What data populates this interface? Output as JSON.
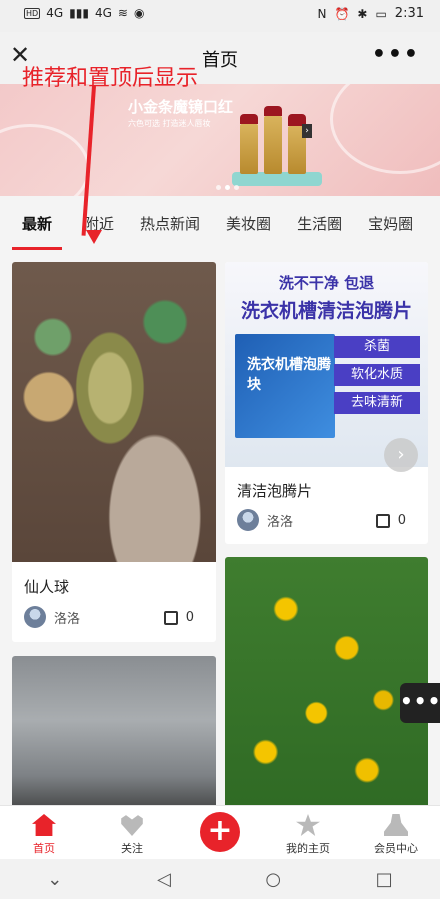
{
  "status_bar": {
    "signal_left": "4G",
    "signal_right": "4G",
    "time": "2:31"
  },
  "nav": {
    "title": "首页",
    "more": "•••"
  },
  "annotation": {
    "text": "推荐和置顶后显示"
  },
  "banner": {
    "title": "小金条魔镜口红",
    "subtitle": "六色可选 打造迷人唇妆",
    "brand": "TREECHADA"
  },
  "tabs": [
    "最新",
    "附近",
    "热点新闻",
    "美妆圈",
    "生活圈",
    "宝妈圈"
  ],
  "cards": [
    {
      "caption": "仙人球",
      "author": "洛洛",
      "likes": "0"
    },
    {
      "caption": "清洁泡腾片",
      "author": "洛洛",
      "likes": "0",
      "ad": {
        "headline": "洗不干净 包退",
        "title": "洗衣机槽清洁泡腾片",
        "tags": [
          "杀菌",
          "软化水质",
          "去味清新"
        ],
        "box_label": "洗衣机槽泡腾块"
      }
    },
    {
      "caption": "",
      "author": "",
      "likes": ""
    },
    {
      "caption": "",
      "author": "",
      "likes": ""
    }
  ],
  "tabbar": [
    {
      "label": "首页",
      "icon": "home-icon"
    },
    {
      "label": "关注",
      "icon": "heart-icon"
    },
    {
      "label": "",
      "icon": "add-icon"
    },
    {
      "label": "我的主页",
      "icon": "star-icon"
    },
    {
      "label": "会员中心",
      "icon": "user-icon"
    }
  ],
  "colors": {
    "accent": "#e8232a",
    "ad_purple": "#4a3fc4"
  }
}
